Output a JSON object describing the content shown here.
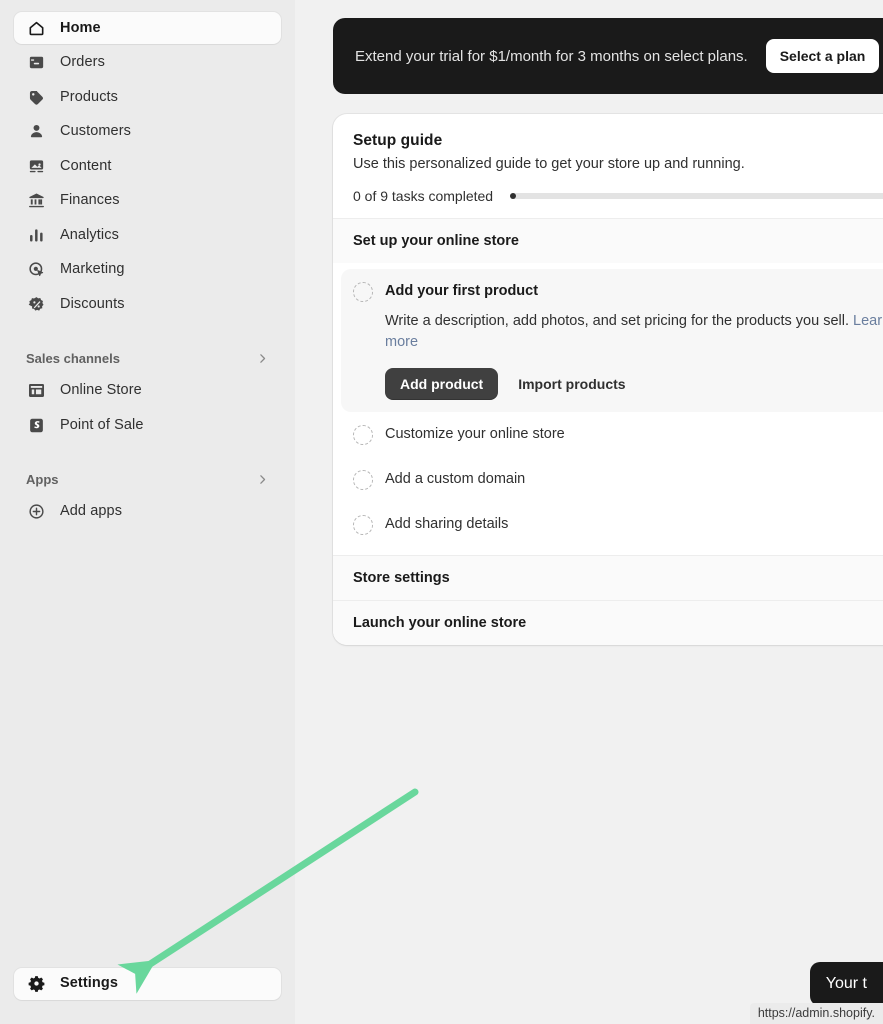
{
  "sidebar": {
    "main_nav": [
      {
        "label": "Home",
        "icon": "home-icon",
        "active": true
      },
      {
        "label": "Orders",
        "icon": "orders-icon",
        "active": false
      },
      {
        "label": "Products",
        "icon": "products-icon",
        "active": false
      },
      {
        "label": "Customers",
        "icon": "customers-icon",
        "active": false
      },
      {
        "label": "Content",
        "icon": "content-icon",
        "active": false
      },
      {
        "label": "Finances",
        "icon": "finances-icon",
        "active": false
      },
      {
        "label": "Analytics",
        "icon": "analytics-icon",
        "active": false
      },
      {
        "label": "Marketing",
        "icon": "marketing-icon",
        "active": false
      },
      {
        "label": "Discounts",
        "icon": "discounts-icon",
        "active": false
      }
    ],
    "sales_channels": {
      "heading": "Sales channels",
      "items": [
        {
          "label": "Online Store",
          "icon": "storefront-icon"
        },
        {
          "label": "Point of Sale",
          "icon": "shopify-bag-icon"
        }
      ]
    },
    "apps": {
      "heading": "Apps",
      "items": [
        {
          "label": "Add apps",
          "icon": "plus-circle-icon"
        }
      ]
    },
    "settings": {
      "label": "Settings",
      "icon": "gear-icon"
    }
  },
  "banner": {
    "message": "Extend your trial for $1/month for 3 months on select plans.",
    "cta_label": "Select a plan"
  },
  "setup_guide": {
    "title": "Setup guide",
    "subtitle": "Use this personalized guide to get your store up and running.",
    "progress_label": "0 of 9 tasks completed",
    "completed": 0,
    "total": 9,
    "sections": [
      {
        "heading": "Set up your online store",
        "tasks": [
          {
            "title": "Add your first product",
            "expanded": true,
            "description_before_link": "Write a description, add photos, and set pricing for the products you sell. ",
            "link_label": "Learn more",
            "primary_action": "Add product",
            "secondary_action": "Import products"
          },
          {
            "title": "Customize your online store",
            "expanded": false
          },
          {
            "title": "Add a custom domain",
            "expanded": false
          },
          {
            "title": "Add sharing details",
            "expanded": false
          }
        ]
      },
      {
        "heading": "Store settings",
        "tasks": []
      },
      {
        "heading": "Launch your online store",
        "tasks": []
      }
    ]
  },
  "overlay": {
    "tooltip_text": "Your t",
    "status_url": "https://admin.shopify.",
    "arrow_color": "#69d79c"
  }
}
